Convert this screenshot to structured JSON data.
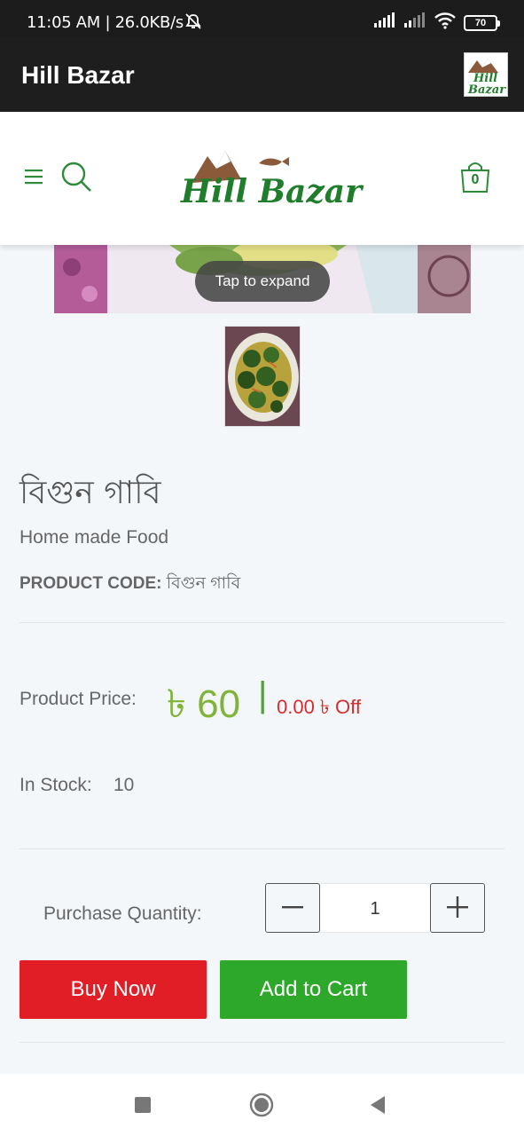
{
  "status_bar": {
    "time_text": "11:05 AM | 26.0KB/s",
    "battery_level": "70"
  },
  "app_bar": {
    "title": "Hill Bazar"
  },
  "header": {
    "cart_count": "0",
    "brand_text": "Hill Bazar"
  },
  "image_overlay": {
    "tap_text": "Tap to expand"
  },
  "product": {
    "name": "বিগুন গাবি",
    "category": "Home made Food",
    "code_label": "PRODUCT CODE:",
    "code_value": "বিগুন গাবি",
    "price_label": "Product Price:",
    "price_value": "৳ 60",
    "price_separator": "|",
    "discount_text": "0.00 ৳ Off",
    "stock_label": "In Stock:",
    "stock_value": "10"
  },
  "purchase": {
    "quantity_label": "Purchase Quantity:",
    "quantity_value": "1",
    "buy_now_label": "Buy Now",
    "add_to_cart_label": "Add to Cart"
  },
  "colors": {
    "accent_green": "#80b33a",
    "brand_green": "#1f7d2c",
    "buy_red": "#e11d26",
    "cart_green": "#2da82b",
    "off_red": "#d32f2f"
  },
  "icons": [
    "mute-icon",
    "signal-icon",
    "wifi-icon",
    "battery-icon",
    "menu-icon",
    "search-icon",
    "cart-bag-icon",
    "minus-icon",
    "plus-icon",
    "nav-recents-icon",
    "nav-home-icon",
    "nav-back-icon"
  ]
}
